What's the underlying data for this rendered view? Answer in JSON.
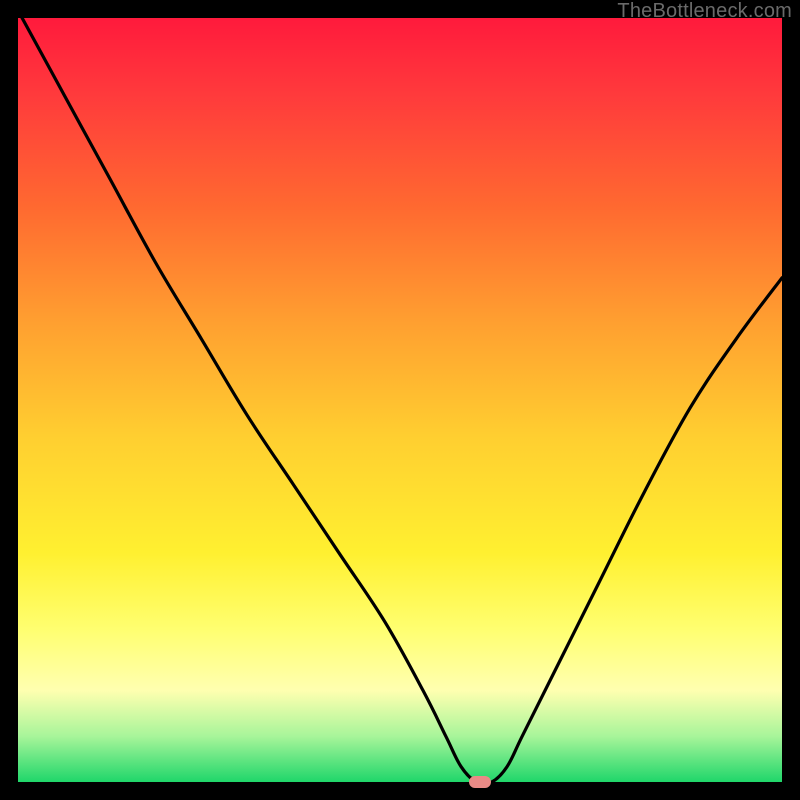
{
  "watermark": "TheBottleneck.com",
  "colors": {
    "page_bg": "#000000",
    "curve": "#000000",
    "marker": "#e98a86",
    "gradient_top": "#ff1a3c",
    "gradient_bottom": "#1fd66a"
  },
  "chart_data": {
    "type": "line",
    "title": "",
    "xlabel": "",
    "ylabel": "",
    "xlim": [
      0,
      100
    ],
    "ylim": [
      0,
      100
    ],
    "grid": false,
    "legend": false,
    "marker": {
      "x": 60.5,
      "y": 0
    },
    "series": [
      {
        "name": "bottleneck-curve",
        "x": [
          0,
          6,
          12,
          18,
          24,
          30,
          36,
          42,
          48,
          53,
          56,
          58,
          60,
          62,
          64,
          66,
          70,
          76,
          82,
          88,
          94,
          100
        ],
        "y": [
          101,
          90,
          79,
          68,
          58,
          48,
          39,
          30,
          21,
          12,
          6,
          2,
          0,
          0,
          2,
          6,
          14,
          26,
          38,
          49,
          58,
          66
        ]
      }
    ]
  }
}
